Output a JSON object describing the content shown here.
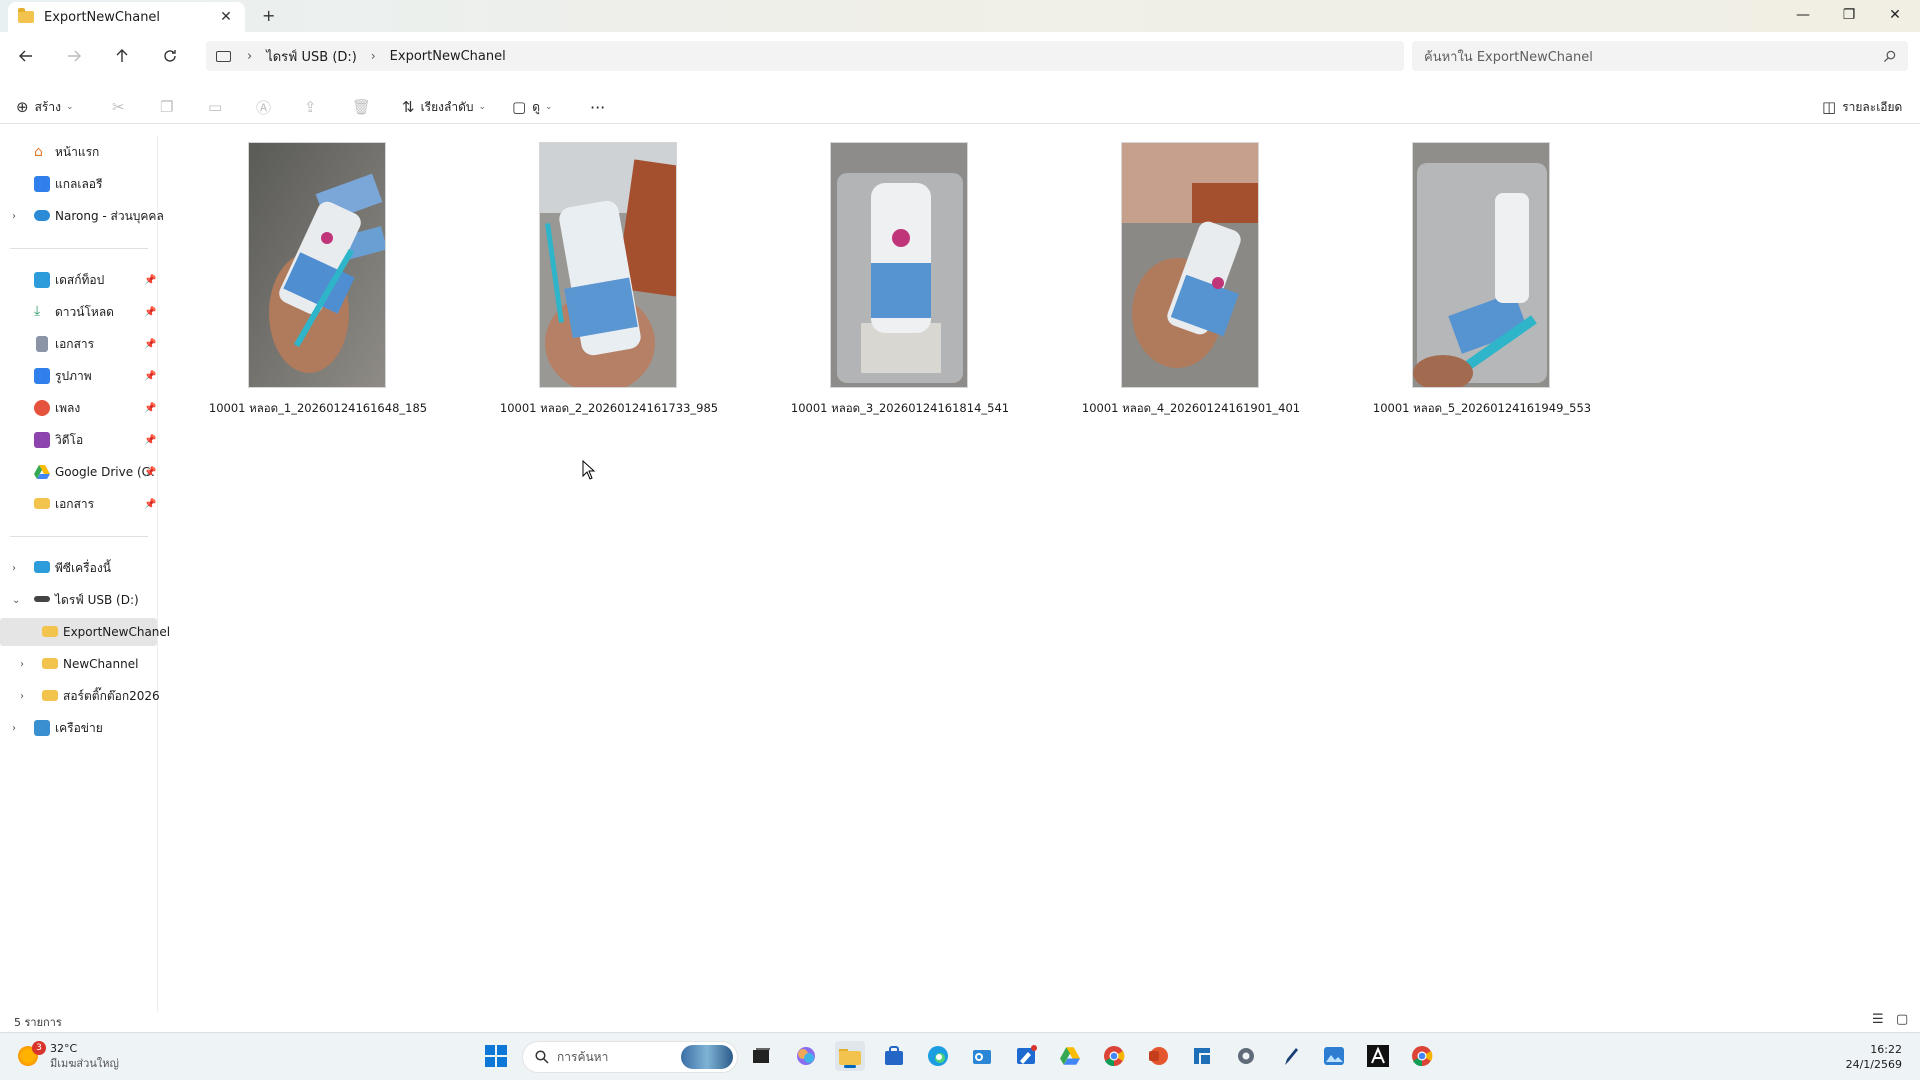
{
  "window": {
    "tab_title": "ExportNewChanel",
    "new_tab": "+",
    "close_tab": "✕",
    "minimize": "—",
    "restore": "❐",
    "close": "✕"
  },
  "address": {
    "drive": "ไดรฟ์ USB (D:)",
    "folder": "ExportNewChanel",
    "separator": "›"
  },
  "search": {
    "placeholder": "ค้นหาใน ExportNewChanel"
  },
  "toolbar": {
    "new_label": "สร้าง",
    "sort_label": "เรียงลำดับ",
    "view_label": "ดู",
    "more_label": "···",
    "details_label": "รายละเอียด"
  },
  "sidebar": {
    "home": "หน้าแรก",
    "gallery": "แกลเลอรี",
    "onedrive": "Narong - ส่วนบุคคล",
    "quick": [
      {
        "label": "เดสก์ท็อป",
        "icon": "desktop-icon",
        "color": "#2d9cdb"
      },
      {
        "label": "ดาวน์โหลด",
        "icon": "download-icon",
        "color": "#2e9e6b"
      },
      {
        "label": "เอกสาร",
        "icon": "document-icon",
        "color": "#8a94a6"
      },
      {
        "label": "รูปภาพ",
        "icon": "pictures-icon",
        "color": "#2f80ed"
      },
      {
        "label": "เพลง",
        "icon": "music-icon",
        "color": "#e5533c"
      },
      {
        "label": "วิดีโอ",
        "icon": "video-icon",
        "color": "#8e44ad"
      },
      {
        "label": "Google Drive (G:",
        "icon": "google-drive-icon",
        "color": "#34a853"
      },
      {
        "label": "เอกสาร",
        "icon": "folder-icon",
        "color": "#f2c34d"
      }
    ],
    "this_pc": "พีซีเครื่องนี้",
    "usb": "ไดรฟ์ USB (D:)",
    "usb_children": [
      "ExportNewChanel",
      "NewChannel",
      "สอร์ตติ๊กต๊อก2026"
    ],
    "network": "เครือข่าย"
  },
  "files": [
    {
      "name": "10001 หลอด_1_20260124161648_185"
    },
    {
      "name": "10001 หลอด_2_20260124161733_985"
    },
    {
      "name": "10001 หลอด_3_20260124161814_541"
    },
    {
      "name": "10001 หลอด_4_20260124161901_401"
    },
    {
      "name": "10001 หลอด_5_20260124161949_553"
    }
  ],
  "status": {
    "count": "5 รายการ"
  },
  "taskbar": {
    "weather_temp": "32°C",
    "weather_desc": "มีเมฆส่วนใหญ่",
    "weather_badge": "3",
    "search_placeholder": "การค้นหา",
    "time": "16:22",
    "date": "24/1/2569"
  }
}
